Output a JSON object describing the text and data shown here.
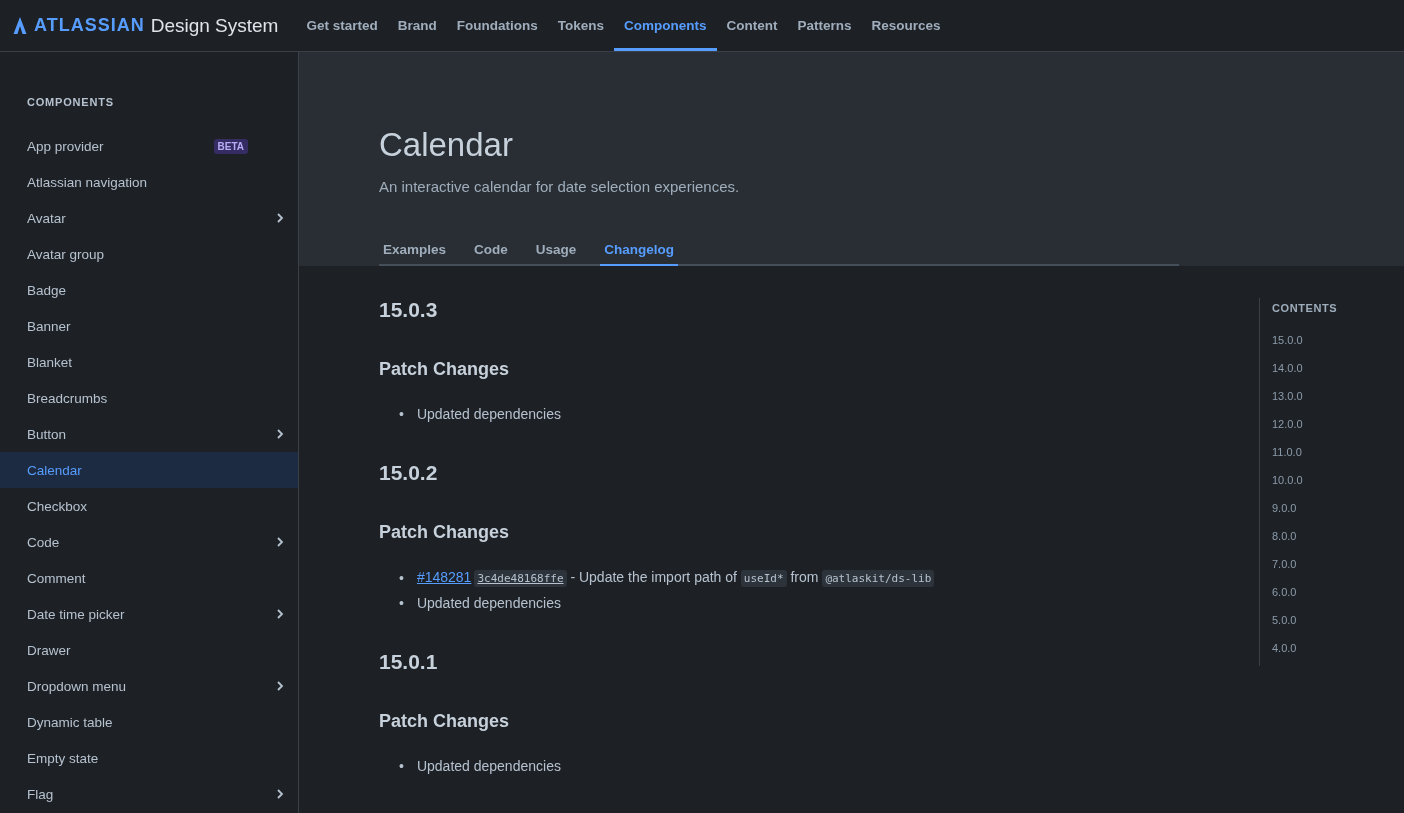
{
  "header": {
    "logo_word": "ATLASSIAN",
    "logo_product": "Design System",
    "nav": [
      {
        "label": "Get started",
        "selected": false
      },
      {
        "label": "Brand",
        "selected": false
      },
      {
        "label": "Foundations",
        "selected": false
      },
      {
        "label": "Tokens",
        "selected": false
      },
      {
        "label": "Components",
        "selected": true
      },
      {
        "label": "Content",
        "selected": false
      },
      {
        "label": "Patterns",
        "selected": false
      },
      {
        "label": "Resources",
        "selected": false
      }
    ]
  },
  "sidebar": {
    "heading": "COMPONENTS",
    "items": [
      {
        "label": "App provider",
        "badge": "BETA",
        "expandable": false,
        "selected": false
      },
      {
        "label": "Atlassian navigation",
        "expandable": false,
        "selected": false
      },
      {
        "label": "Avatar",
        "expandable": true,
        "selected": false
      },
      {
        "label": "Avatar group",
        "expandable": false,
        "selected": false
      },
      {
        "label": "Badge",
        "expandable": false,
        "selected": false
      },
      {
        "label": "Banner",
        "expandable": false,
        "selected": false
      },
      {
        "label": "Blanket",
        "expandable": false,
        "selected": false
      },
      {
        "label": "Breadcrumbs",
        "expandable": false,
        "selected": false
      },
      {
        "label": "Button",
        "expandable": true,
        "selected": false
      },
      {
        "label": "Calendar",
        "expandable": false,
        "selected": true
      },
      {
        "label": "Checkbox",
        "expandable": false,
        "selected": false
      },
      {
        "label": "Code",
        "expandable": true,
        "selected": false
      },
      {
        "label": "Comment",
        "expandable": false,
        "selected": false
      },
      {
        "label": "Date time picker",
        "expandable": true,
        "selected": false
      },
      {
        "label": "Drawer",
        "expandable": false,
        "selected": false
      },
      {
        "label": "Dropdown menu",
        "expandable": true,
        "selected": false
      },
      {
        "label": "Dynamic table",
        "expandable": false,
        "selected": false
      },
      {
        "label": "Empty state",
        "expandable": false,
        "selected": false
      },
      {
        "label": "Flag",
        "expandable": true,
        "selected": false
      }
    ]
  },
  "page": {
    "title": "Calendar",
    "description": "An interactive calendar for date selection experiences.",
    "tabs": [
      {
        "label": "Examples",
        "selected": false
      },
      {
        "label": "Code",
        "selected": false
      },
      {
        "label": "Usage",
        "selected": false
      },
      {
        "label": "Changelog",
        "selected": true
      }
    ]
  },
  "changelog": [
    {
      "version": "15.0.3",
      "heading": "Patch Changes",
      "items": [
        {
          "bullet": "•",
          "segments": [
            {
              "kind": "text",
              "text": "Updated dependencies"
            }
          ]
        }
      ]
    },
    {
      "version": "15.0.2",
      "heading": "Patch Changes",
      "items": [
        {
          "bullet": "•",
          "segments": [
            {
              "kind": "link",
              "text": "#148281"
            },
            {
              "kind": "code_link",
              "text": "3c4de48168ffe"
            },
            {
              "kind": "text",
              "text": " - Update the import path of "
            },
            {
              "kind": "code",
              "text": "useId*"
            },
            {
              "kind": "text",
              "text": " from "
            },
            {
              "kind": "code",
              "text": "@atlaskit/ds-lib"
            }
          ]
        },
        {
          "bullet": "•",
          "segments": [
            {
              "kind": "text",
              "text": "Updated dependencies"
            }
          ]
        }
      ]
    },
    {
      "version": "15.0.1",
      "heading": "Patch Changes",
      "items": [
        {
          "bullet": "•",
          "segments": [
            {
              "kind": "text",
              "text": "Updated dependencies"
            }
          ]
        }
      ]
    }
  ],
  "contents": {
    "heading": "CONTENTS",
    "items": [
      "15.0.0",
      "14.0.0",
      "13.0.0",
      "12.0.0",
      "11.0.0",
      "10.0.0",
      "9.0.0",
      "8.0.0",
      "7.0.0",
      "6.0.0",
      "5.0.0",
      "4.0.0"
    ]
  }
}
